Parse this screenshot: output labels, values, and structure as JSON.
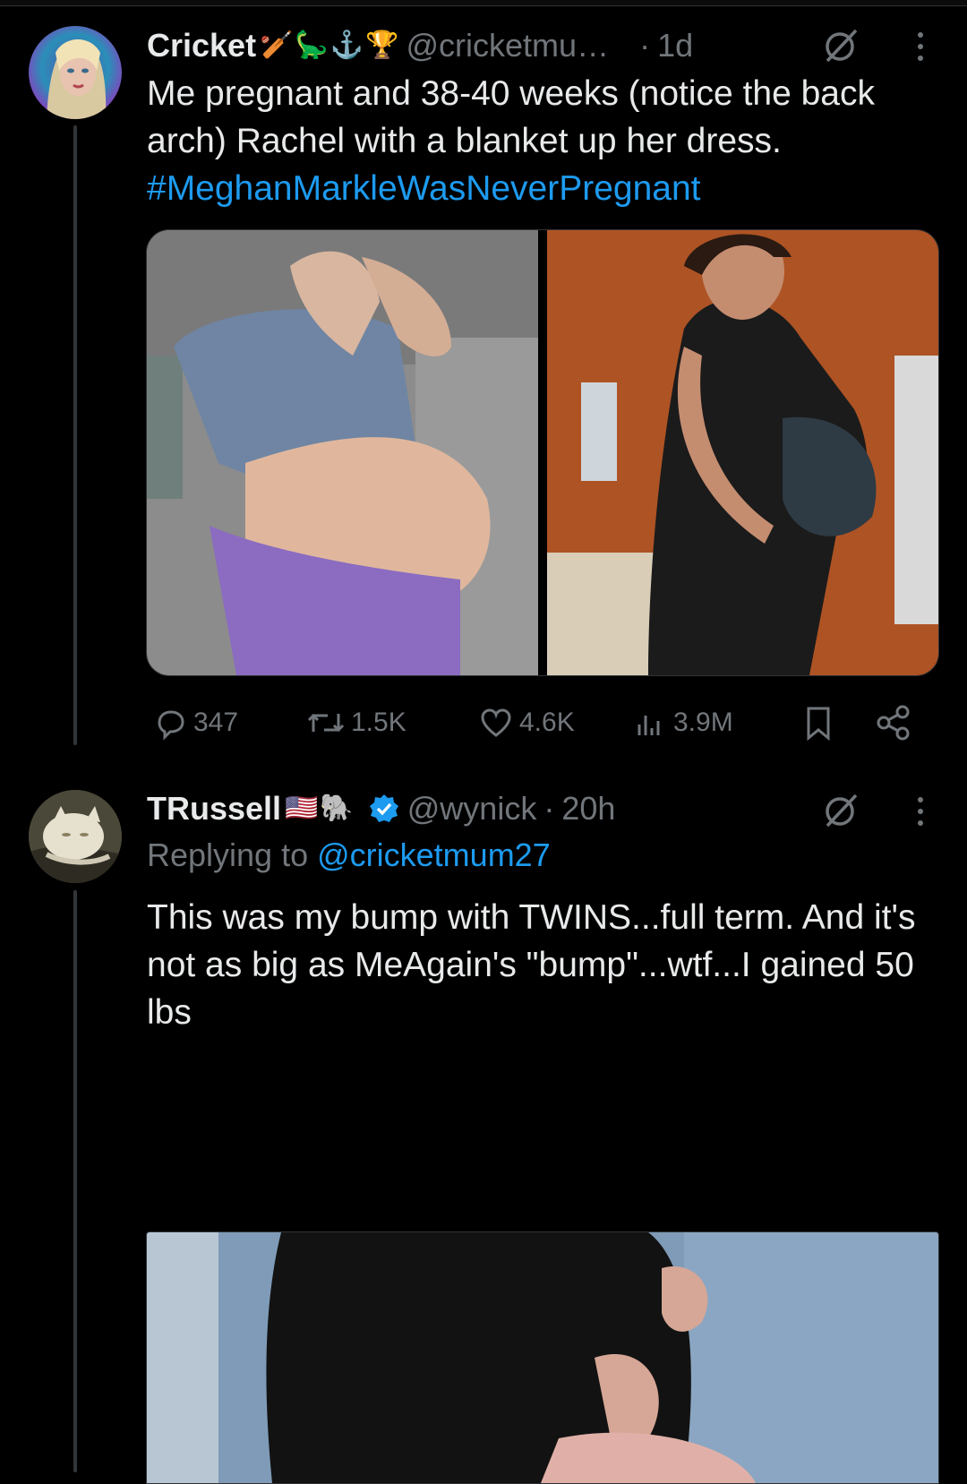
{
  "tweets": [
    {
      "name": "Cricket",
      "emoji_badges": [
        "🏏",
        "🦕",
        "⚓",
        "🏆"
      ],
      "handle": "@cricketmu…",
      "time": "1d",
      "text": "Me pregnant and 38-40 weeks (notice the back arch) Rachel with a blanket up her dress.",
      "hashtag": "#MeghanMarkleWasNeverPregnant",
      "stats": {
        "replies": "347",
        "reposts": "1.5K",
        "likes": "4.6K",
        "views": "3.9M"
      }
    },
    {
      "name": "TRussell",
      "emoji_badges": [
        "🇺🇸",
        "🐘"
      ],
      "verified": true,
      "handle": "@wynick",
      "time": "20h",
      "replying_label": "Replying to",
      "replying_handle": "@cricketmum27",
      "text": "This was my bump with TWINS...full term. And it's not as big as MeAgain's \"bump\"...wtf...I gained 50 lbs"
    }
  ],
  "separator": "·",
  "icons": [
    "reply-icon",
    "repost-icon",
    "like-icon",
    "views-icon",
    "bookmark-icon",
    "share-icon",
    "grok-icon",
    "more-icon",
    "verified-badge-icon"
  ],
  "colors": {
    "background": "#000000",
    "text": "#e7e9ea",
    "muted": "#71767b",
    "accent": "#1d9bf0"
  }
}
